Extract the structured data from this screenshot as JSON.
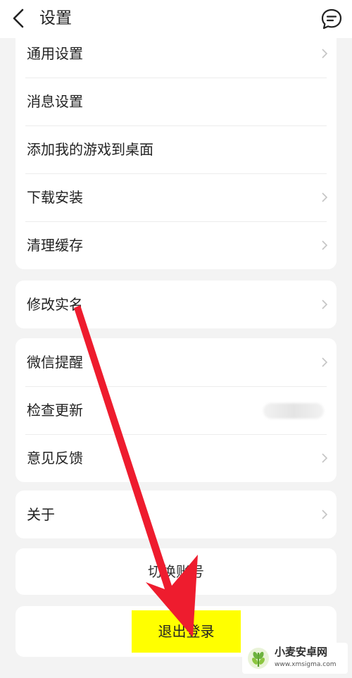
{
  "header": {
    "title": "设置"
  },
  "groups": {
    "general": {
      "items": [
        {
          "label": "通用设置"
        },
        {
          "label": "消息设置"
        },
        {
          "label": "添加我的游戏到桌面"
        },
        {
          "label": "下载安装"
        },
        {
          "label": "清理缓存"
        }
      ]
    },
    "identity": {
      "items": [
        {
          "label": "修改实名"
        }
      ]
    },
    "notify": {
      "items": [
        {
          "label": "微信提醒"
        },
        {
          "label": "检查更新"
        },
        {
          "label": "意见反馈"
        }
      ]
    },
    "about": {
      "items": [
        {
          "label": "关于"
        }
      ]
    }
  },
  "buttons": {
    "switch_account": "切换账号",
    "logout": "退出登录"
  },
  "annotation": {
    "arrow_color": "#ee1c2e",
    "highlight_color": "#ffff00"
  },
  "watermark": {
    "title": "小麦安卓网",
    "url": "www.xmsigma.com"
  }
}
